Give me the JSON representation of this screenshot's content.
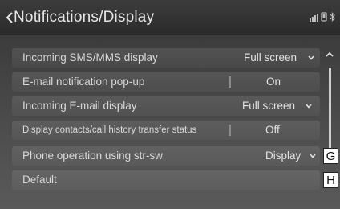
{
  "header": {
    "title": "Notifications/Display",
    "back_icon": "chevron-left-icon",
    "status_icons": [
      "signal-icon",
      "phone-icon",
      "bluetooth-icon"
    ]
  },
  "settings": [
    {
      "label": "Incoming SMS/MMS display",
      "value": "Full screen",
      "control": "dropdown"
    },
    {
      "label": "E-mail notification pop-up",
      "value": "On",
      "control": "toggle"
    },
    {
      "label": "Incoming E-mail display",
      "value": "Full screen",
      "control": "dropdown"
    },
    {
      "label": "Display contacts/call history transfer status",
      "value": "Off",
      "control": "toggle"
    },
    {
      "label": "Phone operation using str-sw",
      "value": "Display",
      "control": "dropdown"
    },
    {
      "label": "Default",
      "value": "",
      "control": "button"
    }
  ],
  "callouts": {
    "g": "G",
    "h": "H"
  },
  "colors": {
    "background": "#4a4a4a",
    "text": "#d9d9d9"
  }
}
